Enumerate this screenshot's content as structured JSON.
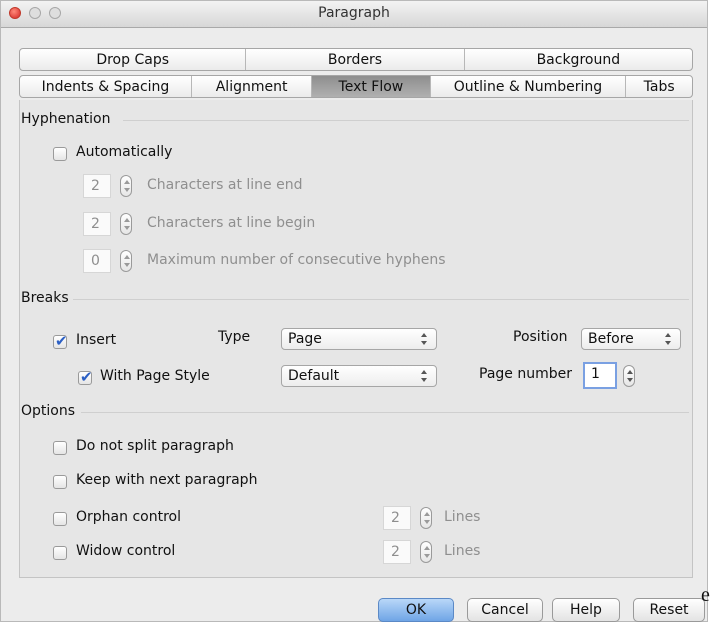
{
  "window": {
    "title": "Paragraph"
  },
  "tabs": {
    "row1": [
      "Drop Caps",
      "Borders",
      "Background"
    ],
    "row2": [
      "Indents & Spacing",
      "Alignment",
      "Text Flow",
      "Outline & Numbering",
      "Tabs"
    ],
    "active": "Text Flow"
  },
  "hyphenation": {
    "heading": "Hyphenation",
    "automatically": {
      "label": "Automatically",
      "checked": false
    },
    "line_end": {
      "value": "2",
      "label": "Characters at line end"
    },
    "line_begin": {
      "value": "2",
      "label": "Characters at line begin"
    },
    "max_hyphens": {
      "value": "0",
      "label": "Maximum number of consecutive hyphens"
    }
  },
  "breaks": {
    "heading": "Breaks",
    "insert": {
      "label": "Insert",
      "checked": true
    },
    "type_label": "Type",
    "type_value": "Page",
    "position_label": "Position",
    "position_value": "Before",
    "with_page_style": {
      "label": "With Page Style",
      "checked": true
    },
    "page_style_value": "Default",
    "page_number_label": "Page number",
    "page_number_value": "1"
  },
  "options": {
    "heading": "Options",
    "do_not_split": {
      "label": "Do not split paragraph",
      "checked": false
    },
    "keep_with_next": {
      "label": "Keep with next paragraph",
      "checked": false
    },
    "orphan": {
      "label": "Orphan control",
      "value": "2",
      "unit": "Lines",
      "checked": false
    },
    "widow": {
      "label": "Widow control",
      "value": "2",
      "unit": "Lines",
      "checked": false
    }
  },
  "buttons": {
    "ok": "OK",
    "cancel": "Cancel",
    "help": "Help",
    "reset": "Reset"
  },
  "stray_text": "e",
  "colors": {
    "accent": "#6fa5e6",
    "check": "#2b5fc4",
    "active_tab": "#9e9e9e"
  }
}
